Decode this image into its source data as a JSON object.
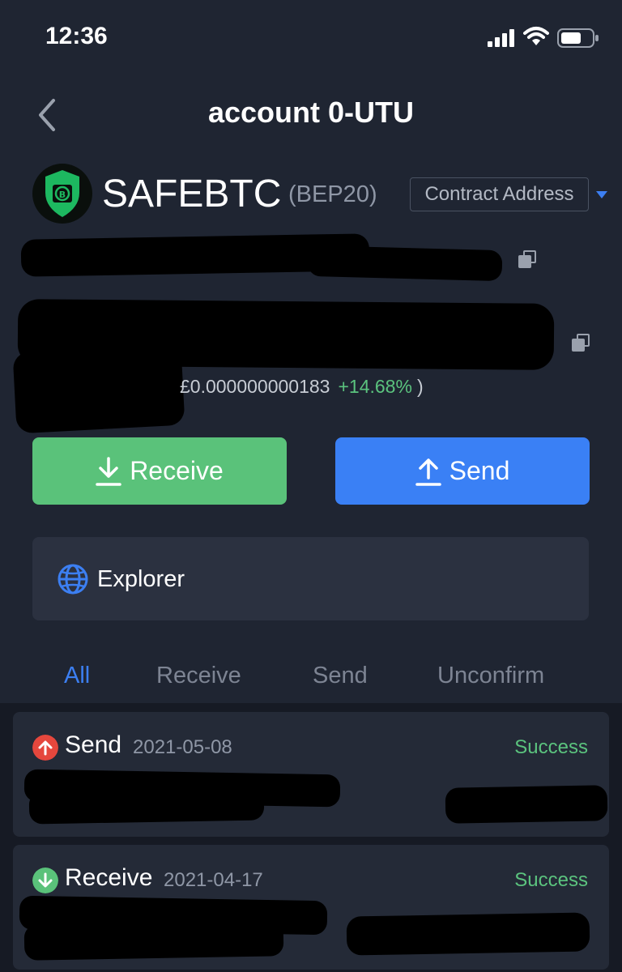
{
  "status_bar": {
    "time": "12:36"
  },
  "header": {
    "title": "account 0-UTU"
  },
  "token": {
    "name": "SAFEBTC",
    "standard": "(BEP20)",
    "contract_label": "Contract Address"
  },
  "price": {
    "value": "£0.000000000183",
    "change": "+14.68%",
    "close": ")"
  },
  "actions": {
    "receive_label": "Receive",
    "send_label": "Send"
  },
  "explorer": {
    "label": "Explorer"
  },
  "tabs": [
    "All",
    "Receive",
    "Send",
    "Unconfirm"
  ],
  "transactions": [
    {
      "type": "Send",
      "date": "2021-05-08",
      "status": "Success"
    },
    {
      "type": "Receive",
      "date": "2021-04-17",
      "status": "Success"
    }
  ],
  "colors": {
    "background": "#1f2532",
    "receive": "#5ac27a",
    "send": "#3a80f5",
    "active_tab": "#3c7ff2",
    "success": "#5bc37e"
  }
}
